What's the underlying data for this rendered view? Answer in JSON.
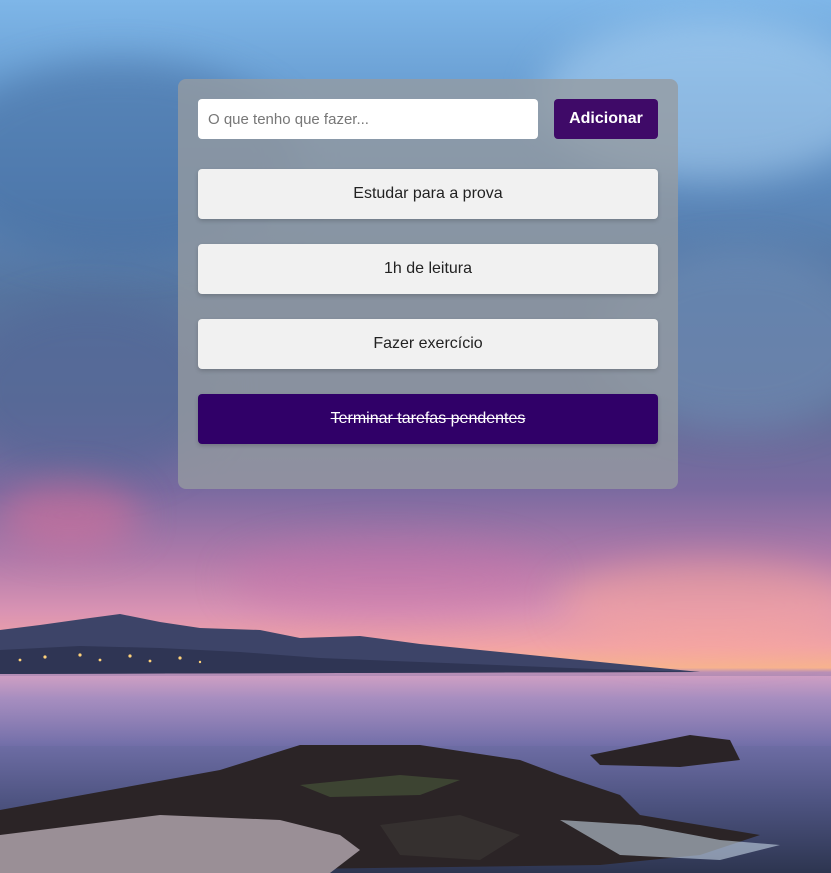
{
  "background": {
    "scene": "sunset-seascape-photo"
  },
  "form": {
    "placeholder": "O que tenho que fazer...",
    "value": "",
    "add_label": "Adicionar",
    "accent_color": "#3f0a68"
  },
  "tasks": [
    {
      "label": "Estudar para a prova",
      "done": false
    },
    {
      "label": "1h de leitura",
      "done": false
    },
    {
      "label": "Fazer exercício",
      "done": false
    },
    {
      "label": "Terminar tarefas pendentes",
      "done": true
    }
  ],
  "colors": {
    "task_bg": "#f1f1f1",
    "task_done_bg": "#300068",
    "panel_bg": "#969ba0"
  }
}
